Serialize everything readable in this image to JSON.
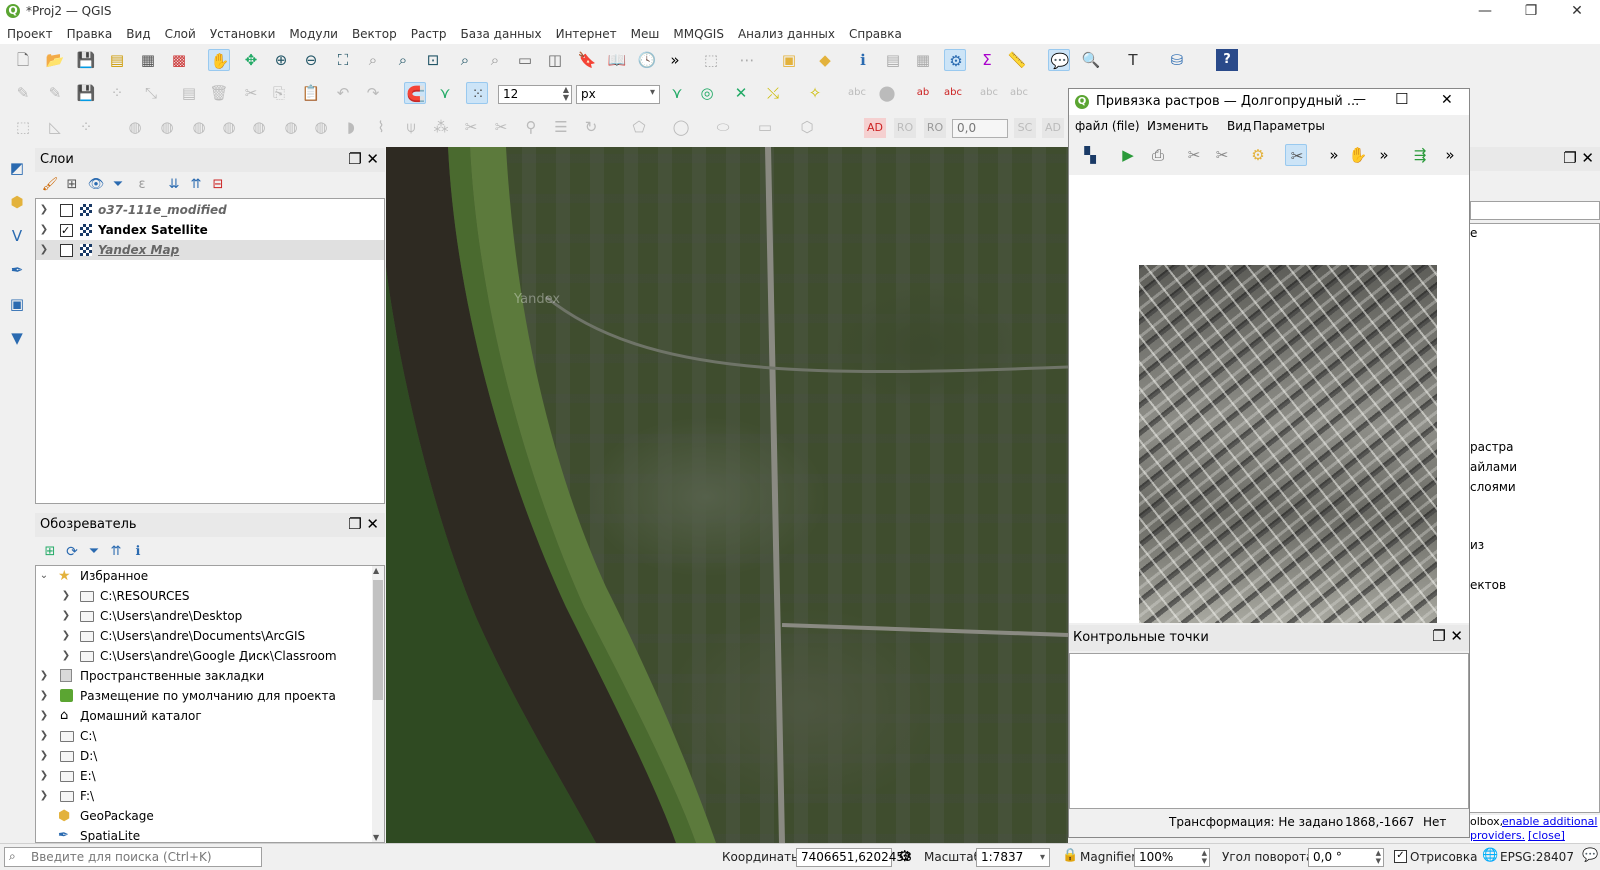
{
  "window": {
    "title": "*Proj2 — QGIS",
    "minimize_glyph": "—",
    "restore_glyph": "❐",
    "close_glyph": "✕"
  },
  "menu": [
    "Проект",
    "Правка",
    "Вид",
    "Слой",
    "Установки",
    "Модули",
    "Вектор",
    "Растр",
    "База данных",
    "Интернет",
    "Меш",
    "MMQGIS",
    "Анализ данных",
    "Справка"
  ],
  "snapping": {
    "tolerance": "12",
    "unit": "px"
  },
  "digitize_toolbar": {
    "ad": "AD",
    "ro": "RO",
    "ad2": "AD",
    "angle": "0,0",
    "sc": "SC"
  },
  "layers_panel": {
    "title": "Слои",
    "layers": [
      {
        "name": "o37-111e_modified",
        "checked": false
      },
      {
        "name": "Yandex Satellite",
        "checked": true
      },
      {
        "name": "Yandex Map",
        "checked": false
      }
    ]
  },
  "browser_panel": {
    "title": "Обозреватель",
    "favorites_label": "Избранное",
    "favorites": [
      "C:\\RESOURCES",
      "C:\\Users\\andre\\Desktop",
      "C:\\Users\\andre\\Documents\\ArcGIS",
      "C:\\Users\\andre\\Google Диск\\Classroom"
    ],
    "items": [
      "Пространственные закладки",
      "Размещение по умолчанию для проекта",
      "Домашний каталог",
      "C:\\",
      "D:\\",
      "E:\\",
      "F:\\",
      "GeoPackage",
      "SpatiaLite"
    ]
  },
  "map": {
    "watermark": "Yandex"
  },
  "georeferencer": {
    "title": "Привязка растров — Долгопрудный ...",
    "menu": [
      "файл (file)",
      "Изменить",
      "Вид",
      "Параметры"
    ],
    "gcp_title": "Контрольные точки",
    "status": {
      "transform": "Трансформация: Не задано",
      "coords": "1868,-1667",
      "crs": "Нет"
    }
  },
  "right_dock": {
    "fragments": [
      "е",
      "растра",
      "айлами",
      "слоями",
      "из",
      "ектов"
    ],
    "link_prefix": "olbox,",
    "link_text": "enable additional",
    "link2": "providers.",
    "close_link": "[close]"
  },
  "statusbar": {
    "search_placeholder": "Введите для поиска (Ctrl+K)",
    "coord_label": "Координаты",
    "coord_value": "7406651,6202458",
    "scale_label": "Масштаб",
    "scale_value": "1:7837",
    "magnifier_label": "Magnifier",
    "magnifier_value": "100%",
    "rotation_label": "Угол поворота",
    "rotation_value": "0,0 °",
    "render_label": "Отрисовка",
    "epsg": "EPSG:28407"
  }
}
